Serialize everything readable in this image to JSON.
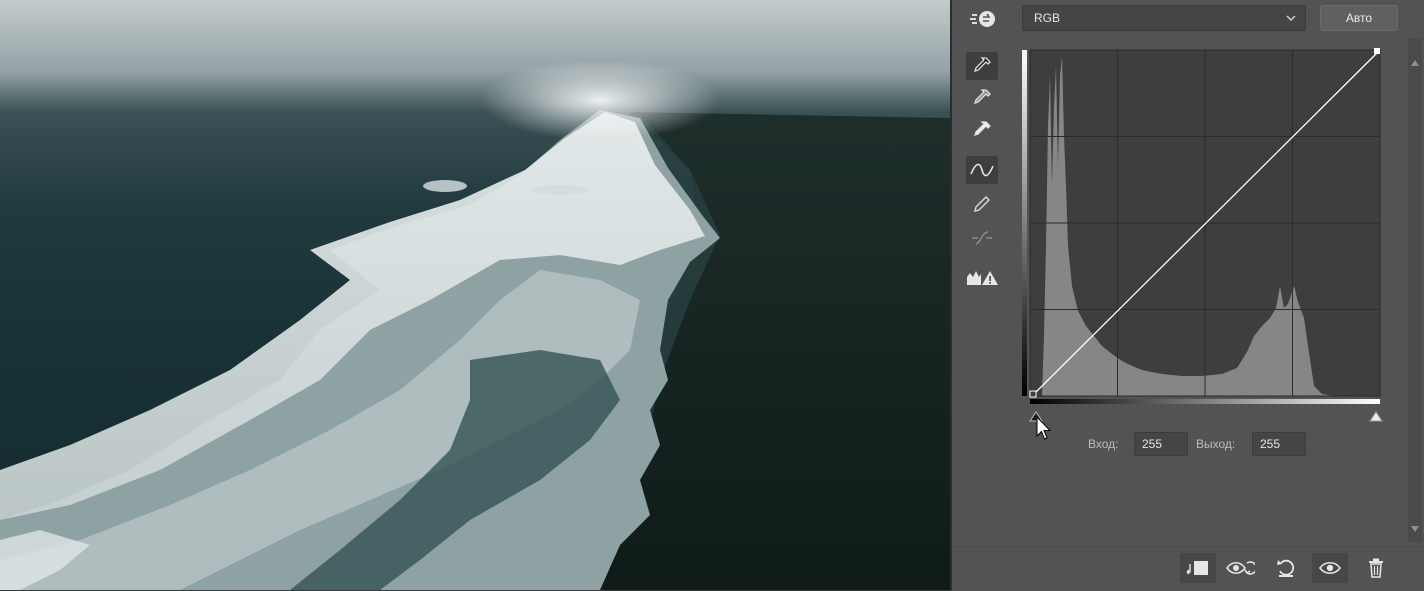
{
  "panel": {
    "adjustment": "curves",
    "channel": {
      "selected": "RGB"
    },
    "auto_label": "Авто",
    "tools": [
      {
        "name": "sample-black-point-eyedropper",
        "icon": "eyedropper-icon",
        "active": true
      },
      {
        "name": "sample-gray-point-eyedropper",
        "icon": "eyedropper-icon",
        "active": false
      },
      {
        "name": "sample-white-point-eyedropper",
        "icon": "eyedropper-icon",
        "active": false
      },
      {
        "name": "edit-points-curve-tool",
        "icon": "curve-icon",
        "active": true
      },
      {
        "name": "draw-curve-pencil-tool",
        "icon": "pencil-icon",
        "active": false
      },
      {
        "name": "smooth-curve-tool",
        "icon": "smooth-icon",
        "active": false,
        "disabled": true
      },
      {
        "name": "clipping-warning-tool",
        "icon": "clipping-warning-icon",
        "active": false
      }
    ],
    "input": {
      "label": "Вход:",
      "value": "255"
    },
    "output": {
      "label": "Выход:",
      "value": "255"
    },
    "footer": [
      {
        "name": "clip-to-layer-button",
        "icon": "clip-to-layer-icon"
      },
      {
        "name": "view-previous-state-button",
        "icon": "eye-previous-icon"
      },
      {
        "name": "reset-defaults-button",
        "icon": "reset-icon"
      },
      {
        "name": "toggle-visibility-button",
        "icon": "eye-icon"
      },
      {
        "name": "delete-adjustment-button",
        "icon": "trash-icon"
      }
    ]
  },
  "colors": {
    "panel_bg": "#535353",
    "graph_bg": "#3e3e3e",
    "histogram": "#8a8a8a",
    "curve_line": "#ffffff"
  }
}
